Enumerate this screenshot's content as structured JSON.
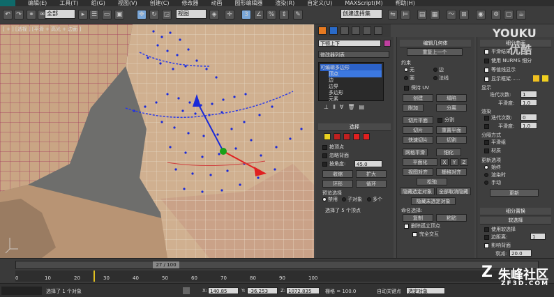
{
  "menu": {
    "items": [
      "编辑(E)",
      "工具(T)",
      "组(G)",
      "视图(V)",
      "创建(C)",
      "修改器",
      "动画",
      "图形编辑器",
      "渲染(R)",
      "自定义(U)",
      "MAXScript(M)",
      "帮助(H)"
    ]
  },
  "toolbar": {
    "selection_filter": "全部",
    "view_dropdown": "视图",
    "selection_set": "创建选择集"
  },
  "viewport": {
    "label": "[ + ] [透视 ] [平滑 + 高光 + 边面 ]"
  },
  "command_panel": {
    "object_name": "下颚上下",
    "modifier_list": "修改器列表",
    "stack": [
      "可编辑多边形",
      "顶点",
      "边",
      "边界",
      "多边形",
      "元素"
    ],
    "selection": {
      "title": "选择",
      "by_vertex": "按顶点",
      "ignore_backfacing": "忽略背面",
      "by_angle": "按角度:",
      "angle_value": "45.0",
      "shrink": "收缩",
      "grow": "扩大",
      "ring": "环形",
      "loop": "循环",
      "preview_title": "预览选择",
      "preview_off": "禁用",
      "preview_subobj": "子对象",
      "preview_multi": "多个",
      "status": "选择了 5 个顶点"
    }
  },
  "edit_geometry": {
    "title": "编辑几何体",
    "repeat_last": "重复上一个",
    "constraints": "约束",
    "none": "无",
    "edge": "边",
    "face": "面",
    "normal": "法线",
    "preserve_uv": "保持 UV",
    "create": "创建",
    "collapse": "塌陷",
    "attach": "附加",
    "detach": "分离",
    "slice_plane": "切片平面",
    "split": "分割",
    "slice": "切片",
    "reset_plane": "重置平面",
    "quickslice": "快速切片",
    "cut": "切割",
    "meshsmooth": "网格平滑",
    "tessellate": "细化",
    "make_planar": "平面化",
    "x": "X",
    "y": "Y",
    "z": "Z",
    "view_align": "视图对齐",
    "grid_align": "栅格对齐",
    "relax": "松弛",
    "hide_selected": "隐藏选定对象",
    "unhide_all": "全部取消隐藏",
    "hide_unselected": "隐藏未选定对象",
    "named_selections": "命名选择:",
    "copy": "复制",
    "paste": "粘贴",
    "delete_isolated": "删除孤立顶点",
    "full_interactivity": "完全交互"
  },
  "subdivision": {
    "title": "细分曲面",
    "smooth_result": "平滑结果",
    "use_nurms": "使用 NURMS 细分",
    "isoline_display": "等值线显示",
    "show_cage": "显示框架......",
    "display": "显示",
    "iterations_label": "迭代次数:",
    "iterations_value": "1",
    "smoothness_label": "平滑度:",
    "smoothness_value": "1.0",
    "render": "渲染",
    "render_iter_value": "0",
    "render_smooth_value": "1.0",
    "separate_by": "分隔方式",
    "smoothing_groups": "平滑组",
    "materials": "材质",
    "update_options": "更新选项",
    "always": "始终",
    "when_rendering": "渲染时",
    "manually": "手动",
    "update": "更新",
    "subdiv_displacement": "细分置换",
    "soft_selection": "软选择",
    "use_soft_selection": "使用软选择",
    "edge_distance": "边距离:",
    "edge_distance_value": "1",
    "affect_backfacing": "影响背面",
    "falloff_label": "衰减:",
    "falloff_value": "20.0",
    "pinch_label": "收缩:",
    "pinch_value": "0.0"
  },
  "timeline": {
    "frame": "27 / 100",
    "ticks": [
      "0",
      "10",
      "20",
      "30",
      "40",
      "50",
      "60",
      "70",
      "80",
      "90",
      "100"
    ]
  },
  "status": {
    "message": "选择了 1 个对象",
    "x_label": "X:",
    "x_value": "140.85",
    "y_label": "Y:",
    "y_value": "-36.253",
    "z_label": "Z:",
    "z_value": "1072.835",
    "grid": "栅格 = 100.0",
    "autokey": "自动关键点",
    "selected": "选定对象"
  },
  "watermarks": {
    "youku": "YOUKU",
    "youku_cn": "优酷",
    "site_cn": "朱峰社区",
    "site_en": "ZF3D.COM"
  },
  "colors": {
    "skin": "#c8a888",
    "wire": "#a0305a",
    "selected_vertex": "#1a2ad8",
    "panel": "#3c3c3c",
    "stack_highlight": "#2c62c8"
  }
}
